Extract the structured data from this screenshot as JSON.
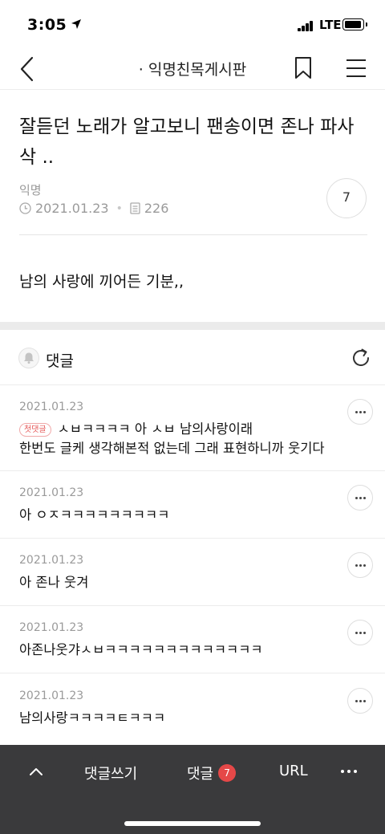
{
  "status_bar": {
    "time": "3:05",
    "network": "LTE"
  },
  "nav": {
    "title": "· 익명친목게시판",
    "icons": [
      "back-chevron-icon",
      "bookmark-icon",
      "menu-icon"
    ]
  },
  "post": {
    "title": "잘듣던 노래가 알고보니 팬송이면 존나 파사삭 ..",
    "author": "익명",
    "date": "2021.01.23",
    "views": "226",
    "likes": "7",
    "body": "남의 사랑에 끼어든 기분,,"
  },
  "comments_section": {
    "label": "댓글",
    "comments": [
      {
        "date": "2021.01.23",
        "badge": "첫댓글",
        "line1": "ㅅㅂㅋㅋㅋㅋ 아 ㅅㅂ 남의사랑이래",
        "line2": "한번도 글케 생각해본적 없는데 그래 표현하니까 웃기다"
      },
      {
        "date": "2021.01.23",
        "text": "아 ㅇㅈㅋㅋㅋㅋㅋㅋㅋㅋㅋ"
      },
      {
        "date": "2021.01.23",
        "text": "아 존나 웃겨"
      },
      {
        "date": "2021.01.23",
        "text": "아존나웃갸ㅅㅂㅋㅋㅋㅋㅋㅋㅋㅋㅋㅋㅋㅋㅋ"
      },
      {
        "date": "2021.01.23",
        "text": "남의사랑ㅋㅋㅋㅋㅌㅋㅋㅋ"
      }
    ]
  },
  "bottom_bar": {
    "write_label": "댓글쓰기",
    "comments_label": "댓글",
    "comments_count": "7",
    "url_label": "URL"
  },
  "colors": {
    "accent_red": "#e54848",
    "bottom_bar_bg": "#3a3a3c",
    "muted_text": "#9a9a9a"
  }
}
